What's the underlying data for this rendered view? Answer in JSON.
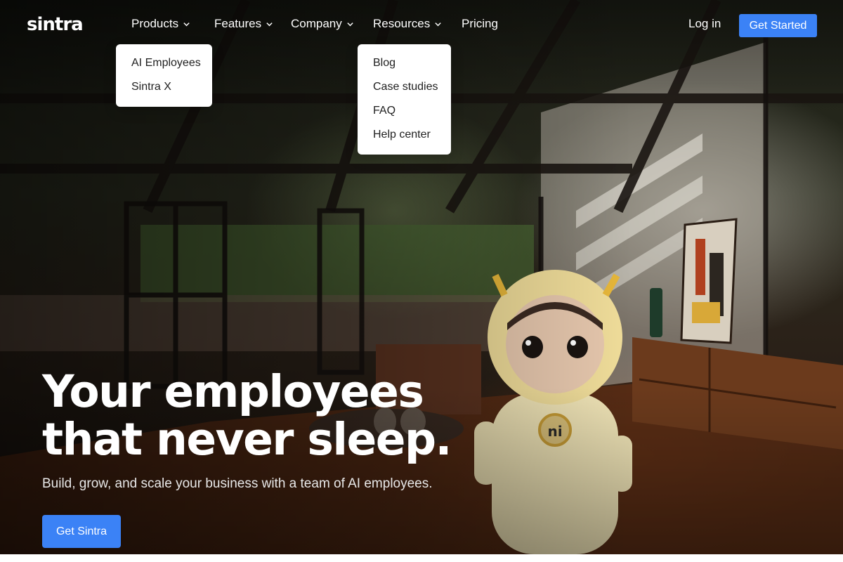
{
  "brand": {
    "logo_text": "sintra"
  },
  "nav": {
    "items": [
      {
        "label": "Products",
        "has_dropdown": true
      },
      {
        "label": "Features",
        "has_dropdown": true
      },
      {
        "label": "Company",
        "has_dropdown": true
      },
      {
        "label": "Resources",
        "has_dropdown": true
      },
      {
        "label": "Pricing",
        "has_dropdown": false
      }
    ],
    "login_label": "Log in",
    "cta_label": "Get Started"
  },
  "dropdowns": {
    "products": [
      "AI Employees",
      "Sintra X"
    ],
    "resources": [
      "Blog",
      "Case studies",
      "FAQ",
      "Help center"
    ]
  },
  "hero": {
    "headline_line1": "Your employees",
    "headline_line2": "that never sleep.",
    "subheadline": "Build, grow, and scale your business with a team of AI employees.",
    "cta_label": "Get Sintra",
    "badge_text": "ni"
  },
  "colors": {
    "accent": "#3b82f6",
    "text_light": "#ffffff",
    "dropdown_bg": "#ffffff"
  }
}
